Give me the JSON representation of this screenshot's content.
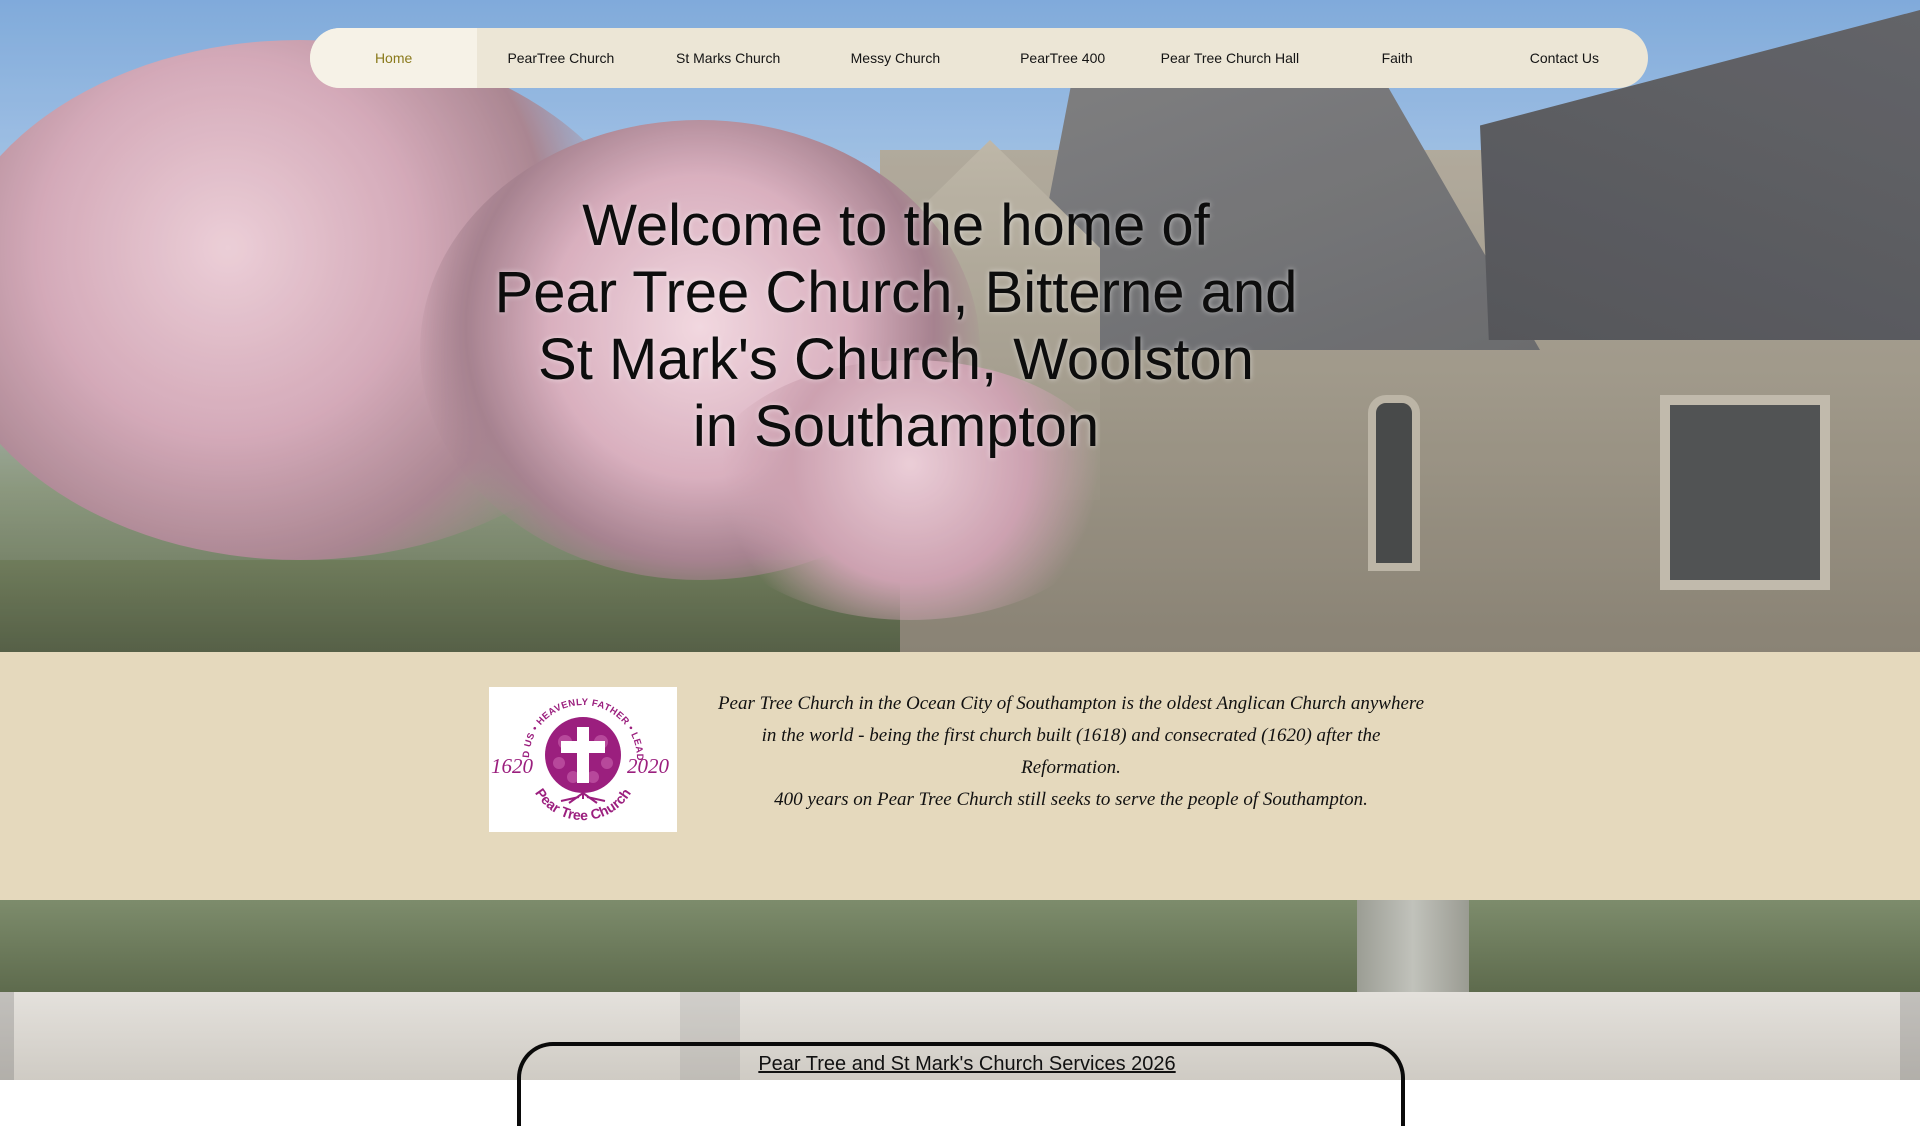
{
  "nav": {
    "items": [
      {
        "label": "Home",
        "active": true
      },
      {
        "label": "PearTree Church"
      },
      {
        "label": "St Marks Church"
      },
      {
        "label": "Messy Church"
      },
      {
        "label": "PearTree 400"
      },
      {
        "label": "Pear Tree Church Hall"
      },
      {
        "label": "Faith"
      },
      {
        "label": "Contact Us"
      }
    ],
    "active_color": "#8a7a1c"
  },
  "hero": {
    "title_lines": [
      "Welcome to the home of",
      "Pear Tree Church, Bitterne and",
      "St Mark's Church, Woolston",
      "in Southampton"
    ]
  },
  "logo": {
    "arc_text": "LEAD US • HEAVENLY FATHER • LEAD US",
    "year_left": "1620",
    "year_right": "2020",
    "bottom_text": "Pear Tree Church",
    "color": "#9b1f7e"
  },
  "intro": {
    "paragraph": "Pear Tree Church in the Ocean City of Southampton is the oldest Anglican Church anywhere in the world - being the first church built (1618) and consecrated (1620) after the Reformation.",
    "line2": "400 years on Pear Tree Church still seeks to serve the people of Southampton."
  },
  "services": {
    "title": "Pear Tree and St Mark's Church Services 2026"
  },
  "colors": {
    "nav_bg": "#ece6d6",
    "band_bg": "#e5d9bd"
  }
}
